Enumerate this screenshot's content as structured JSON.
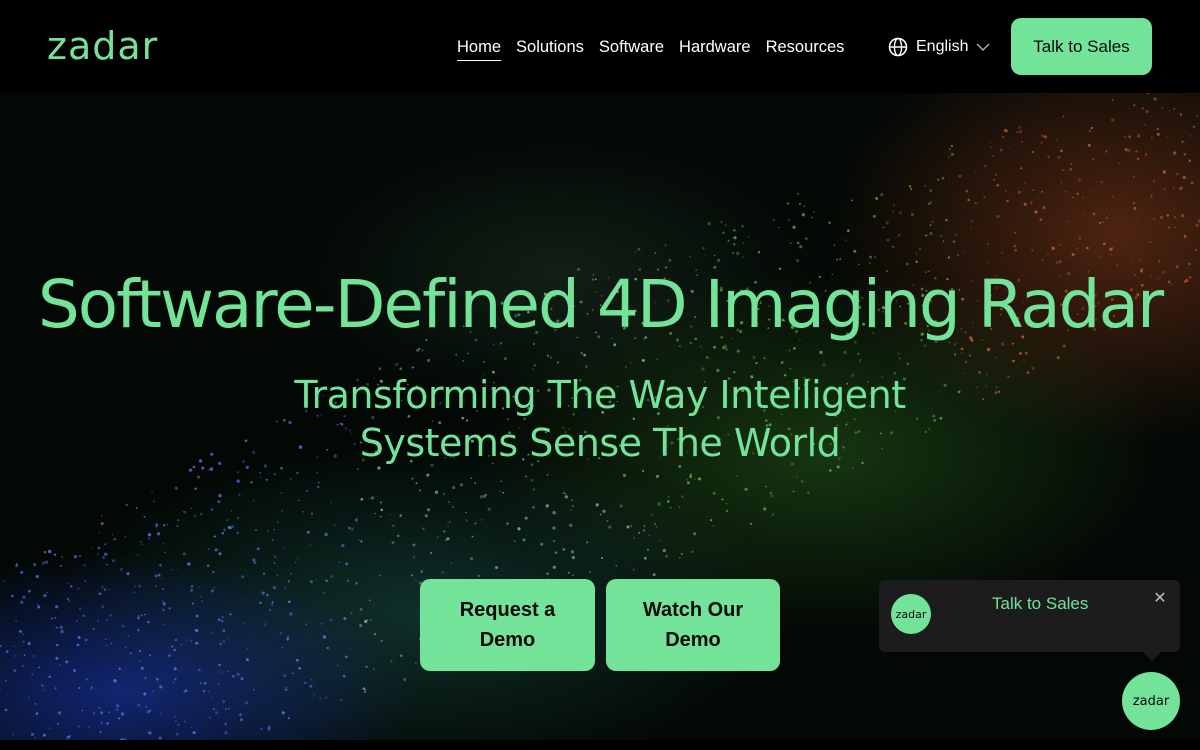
{
  "brand": {
    "logo_text": "zadar",
    "accent": "#74e39a"
  },
  "nav": {
    "items": [
      {
        "label": "Home",
        "active": true
      },
      {
        "label": "Solutions"
      },
      {
        "label": "Software"
      },
      {
        "label": "Hardware"
      },
      {
        "label": "Resources"
      }
    ],
    "language": {
      "icon": "globe-icon",
      "label": "English",
      "chevron": "chevron-down-icon"
    },
    "cta_label": "Talk to Sales"
  },
  "hero": {
    "title": "Software-Defined 4D Imaging Radar",
    "subtitle_line1": "Transforming The Way Intelligent",
    "subtitle_line2": "Systems Sense The World",
    "buttons": [
      {
        "label": "Request a Demo"
      },
      {
        "label": "Watch Our Demo"
      }
    ]
  },
  "chat": {
    "avatar_text": "zadar",
    "label": "Talk to Sales",
    "close_icon": "close-icon",
    "launcher_text": "zadar"
  }
}
